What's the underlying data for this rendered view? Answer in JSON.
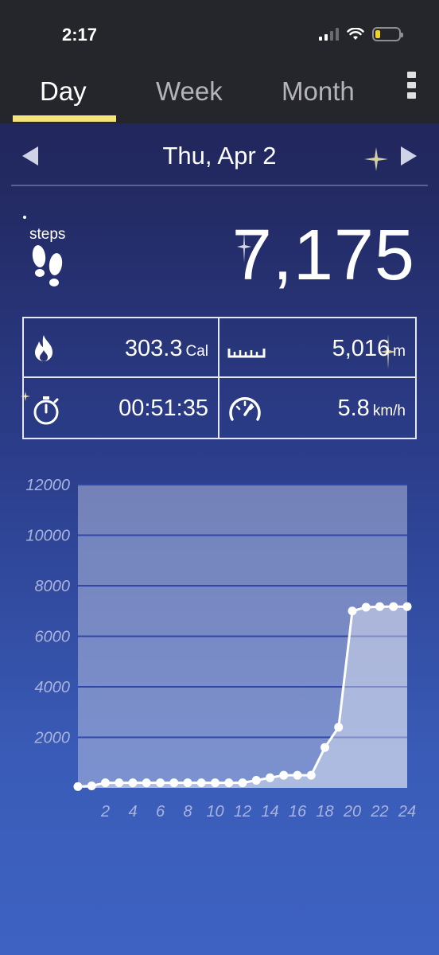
{
  "status": {
    "time": "2:17"
  },
  "tabs": [
    {
      "label": "Day",
      "active": true
    },
    {
      "label": "Week",
      "active": false
    },
    {
      "label": "Month",
      "active": false
    }
  ],
  "date": {
    "label": "Thu, Apr 2"
  },
  "steps": {
    "label": "steps",
    "value": "7,175"
  },
  "stats": {
    "calories": {
      "value": "303.3",
      "unit": "Cal",
      "icon": "flame-icon"
    },
    "distance": {
      "value": "5,016",
      "unit": "m",
      "icon": "ruler-icon"
    },
    "duration": {
      "value": "00:51:35",
      "unit": "",
      "icon": "stopwatch-icon"
    },
    "speed": {
      "value": "5.8",
      "unit": "km/h",
      "icon": "speedometer-icon"
    }
  },
  "colors": {
    "accent": "#f4e479",
    "header_bg": "#25262c"
  },
  "chart_data": {
    "type": "area",
    "x": [
      0,
      1,
      2,
      3,
      4,
      5,
      6,
      7,
      8,
      9,
      10,
      11,
      12,
      13,
      14,
      15,
      16,
      17,
      18,
      19,
      20,
      21,
      22,
      23,
      24
    ],
    "values": [
      50,
      80,
      200,
      200,
      200,
      200,
      200,
      200,
      200,
      200,
      200,
      200,
      200,
      300,
      400,
      500,
      500,
      500,
      1600,
      2400,
      7000,
      7150,
      7175,
      7175,
      7175
    ],
    "ylim": [
      0,
      12000
    ],
    "yticks": [
      "12000",
      "10000",
      "8000",
      "6000",
      "4000",
      "2000"
    ],
    "xticks": [
      "2",
      "4",
      "6",
      "8",
      "10",
      "12",
      "14",
      "16",
      "18",
      "20",
      "22",
      "24"
    ],
    "grid": true
  }
}
